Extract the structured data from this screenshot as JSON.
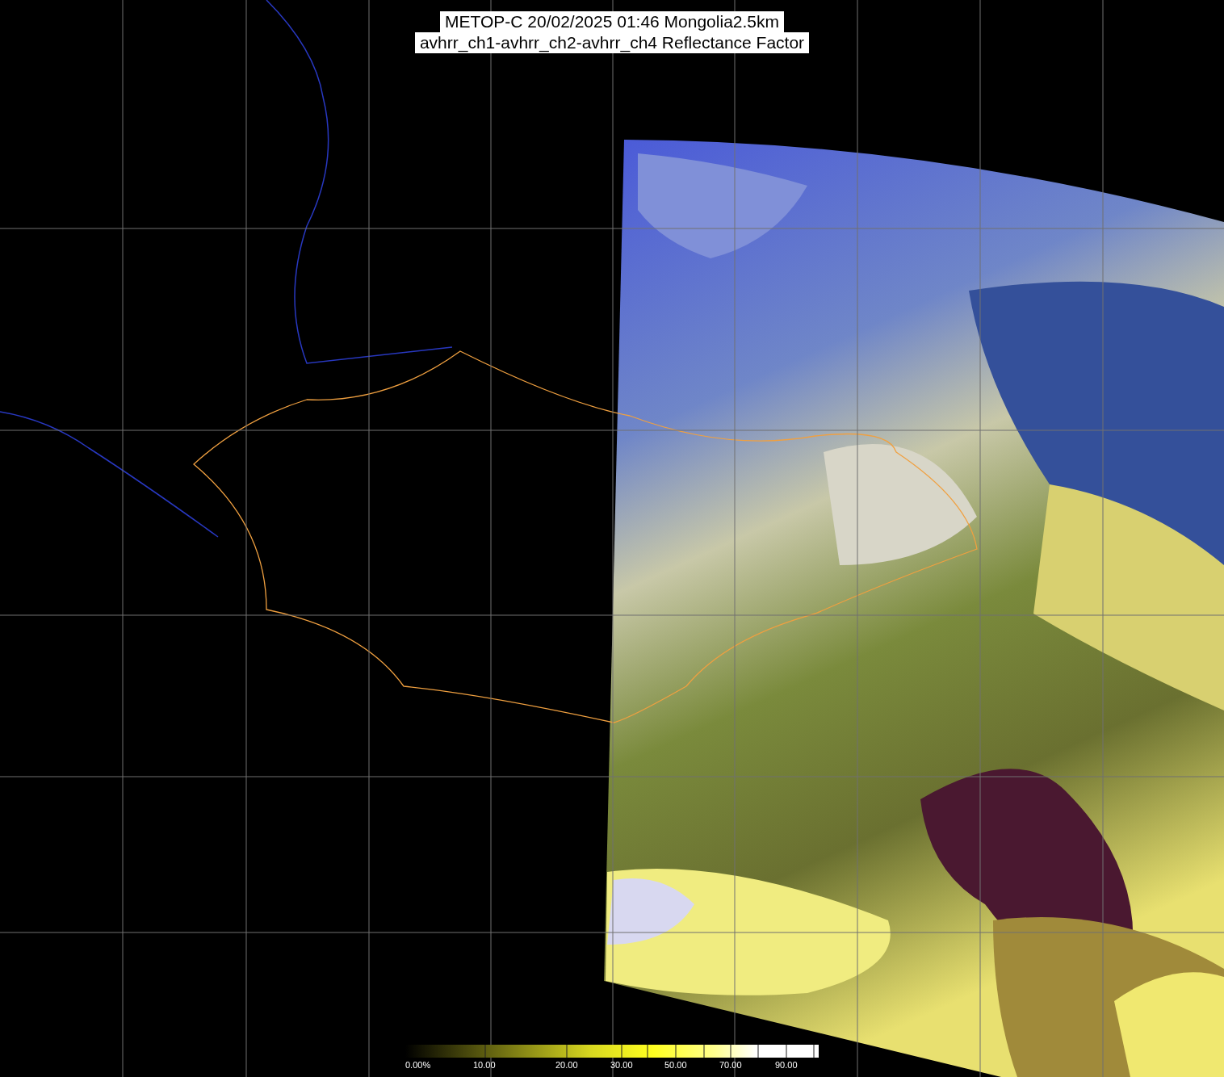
{
  "title": {
    "lines": [
      "METOP-C 20/02/2025 01:46 Mongolia2.5km",
      "avhrr_ch1-avhrr_ch2-avhrr_ch4 Reflectance Factor"
    ]
  },
  "colorbar": {
    "labels": [
      "0.00%",
      "10.00",
      "20.00",
      "30.00",
      "50.00",
      "70.00",
      "90.00"
    ]
  }
}
